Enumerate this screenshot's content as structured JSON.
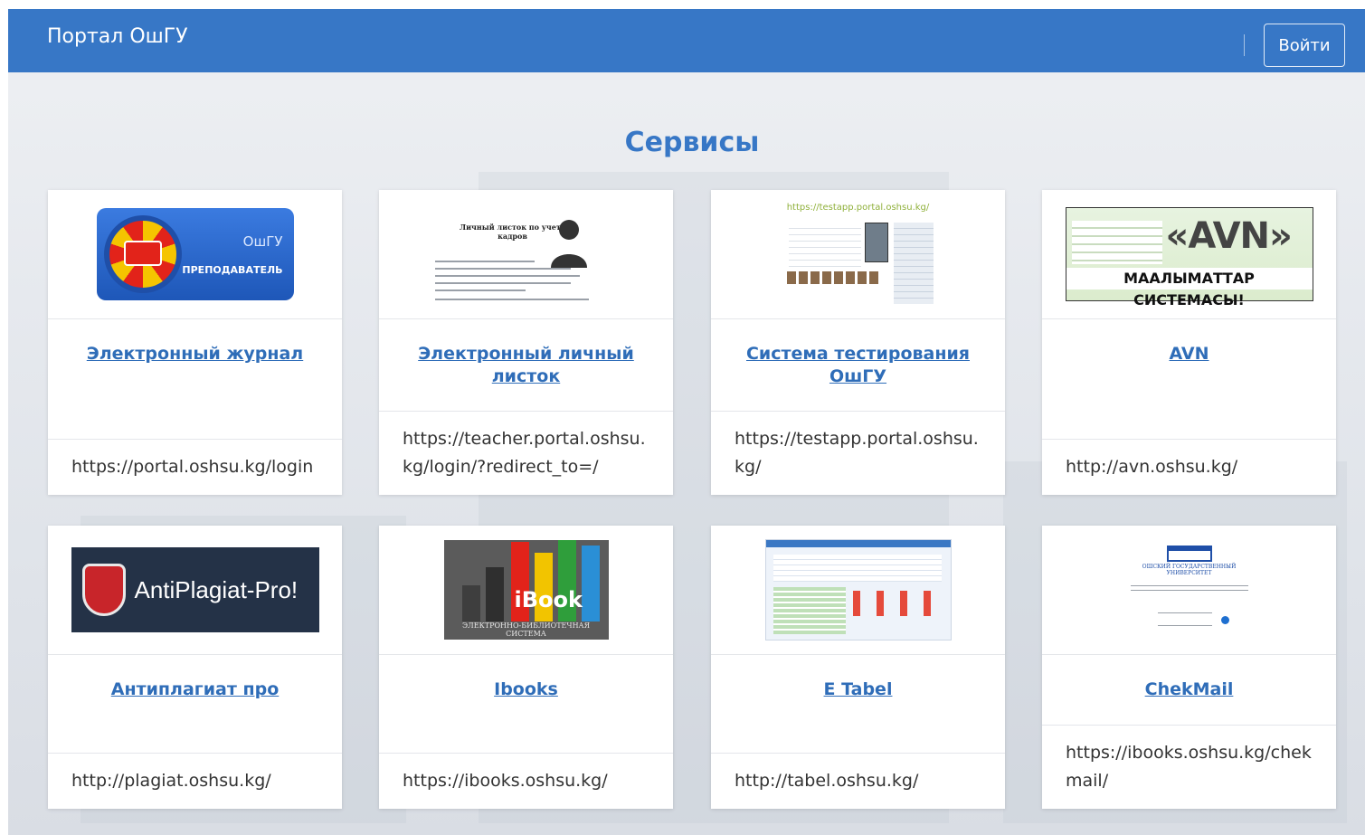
{
  "navbar": {
    "brand": "Портал ОшГУ",
    "login_label": "Войти"
  },
  "section_title": "Сервисы",
  "colors": {
    "navbar": "#3777c6",
    "title": "#3777c6",
    "link": "#2f6db8"
  },
  "cards": [
    {
      "title": "Электронный журнал",
      "url": "https://portal.oshsu.kg/login",
      "thumb": {
        "brand": "ОшГУ",
        "caption": "ПРЕПОДАВАТЕЛЬ"
      }
    },
    {
      "title": "Электронный личный листок",
      "url": "https://teacher.portal.oshsu.kg/login/?redirect_to=/",
      "thumb": {
        "heading": "Личный листок по учету кадров"
      }
    },
    {
      "title": "Система тестирования ОшГУ",
      "url": "https://testapp.portal.oshsu.kg/",
      "thumb": {
        "url": "https://testapp.portal.oshsu.kg/"
      }
    },
    {
      "title": "AVN",
      "url": "http://avn.oshsu.kg/",
      "thumb": {
        "big": "«AVN»",
        "bar": "МААЛЫМАТТАР СИСТЕМАСЫ!"
      }
    },
    {
      "title": "Антиплагиат про",
      "url": "http://plagiat.oshsu.kg/",
      "thumb": {
        "text": "AntiPlagiat-Pro!"
      }
    },
    {
      "title": "Ibooks",
      "url": "https://ibooks.oshsu.kg/",
      "thumb": {
        "word": "iBook",
        "caption": "ЭЛЕКТРОННО-БИБЛИОТЕЧНАЯ СИСТЕМА"
      }
    },
    {
      "title": "E Tabel",
      "url": "http://tabel.oshsu.kg/"
    },
    {
      "title": "ChekMail",
      "url": "https://ibooks.oshsu.kg/chekmail/",
      "thumb": {
        "heading": "ОШСКИЙ ГОСУДАРСТВЕННЫЙ УНИВЕРСИТЕТ"
      }
    }
  ]
}
